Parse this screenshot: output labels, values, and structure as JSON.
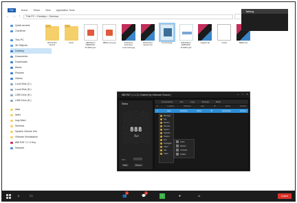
{
  "explorer": {
    "menu": [
      "File",
      "Home",
      "Share",
      "View",
      "Application Tools"
    ],
    "address": "This PC  >  Desktop  >  Seminar",
    "sidebar": [
      {
        "label": "Quick access",
        "color": "#4d8fd8"
      },
      {
        "label": "OneDrive",
        "color": "#4d8fd8"
      },
      {
        "label": "This PC",
        "color": "#4d8fd8"
      },
      {
        "label": "3D Objects",
        "color": "#5aa0e6"
      },
      {
        "label": "Desktop",
        "color": "#3b7fd1"
      },
      {
        "label": "Documents",
        "color": "#5f8fc2"
      },
      {
        "label": "Downloads",
        "color": "#3b7fd1"
      },
      {
        "label": "Music",
        "color": "#3b7fd1"
      },
      {
        "label": "Pictures",
        "color": "#3b7fd1"
      },
      {
        "label": "Videos",
        "color": "#3b7fd1"
      },
      {
        "label": "Local Disk (C:)",
        "color": "#8aa6c2"
      },
      {
        "label": "Local Disk (D:)",
        "color": "#8aa6c2"
      },
      {
        "label": "USB Drive (E:)",
        "color": "#8aa6c2"
      },
      {
        "label": "USB Drive (E:)",
        "color": "#8aa6c2"
      },
      {
        "label": "data",
        "color": "#f4cf6a"
      },
      {
        "label": "defer",
        "color": "#f4cf6a"
      },
      {
        "label": "Img-Ware",
        "color": "#f4cf6a"
      },
      {
        "label": "Seminar",
        "color": "#f4cf6a"
      },
      {
        "label": "System Volume Info",
        "color": "#f4cf6a"
      },
      {
        "label": "VMware Workstation",
        "color": "#f4cf6a"
      },
      {
        "label": "888 RAT 1.1.3 Key",
        "color": "#c32e5b"
      },
      {
        "label": "Network",
        "color": "#4d8fd8"
      }
    ],
    "files": [
      {
        "name": "BOOS Ref Injector",
        "kind": "folder"
      },
      {
        "name": "Florin",
        "kind": "folder"
      },
      {
        "name": "~$RATEGY-WEBINAR-SLIDES.pptx",
        "kind": "pdf"
      },
      {
        "name": "888rat-res.pptx",
        "kind": "pdf"
      },
      {
        "name": "advanced-keyboard-screenshot.jpg",
        "kind": "rar"
      },
      {
        "name": "BOOS Ref Injector.zip",
        "kind": "rar"
      },
      {
        "name": "Icomsi-0.jpg",
        "kind": "img"
      },
      {
        "name": "STRATEGY-WEBINAR-SLIDES.pptx",
        "kind": "docimg"
      },
      {
        "name": "Islagrat.zip",
        "kind": "rar"
      },
      {
        "name": "Infostl",
        "kind": "blank"
      },
      {
        "name": "888rat.zip",
        "kind": "rar"
      }
    ]
  },
  "talking": {
    "label": "Talking"
  },
  "rat_window": {
    "title": "888 RAT  |  1.1.3  |  Cracked by Unknown Source  |",
    "controls": [
      "—",
      "□",
      "✕"
    ],
    "left_tab": "Status",
    "logo": "888",
    "logo_sub": "Rat",
    "ports_label": "Port",
    "start_label": "Start",
    "listen_label": "Pause",
    "top_tabs": [
      "Connections",
      "Info",
      "Logs",
      "Settings",
      "Build"
    ],
    "columns": [
      "#",
      "Location",
      "Windows",
      "User",
      "IP",
      "Status",
      "Country"
    ],
    "row": [
      "1",
      "Auto",
      "Windows",
      "10Pro",
      "IP",
      "Connected",
      "Country"
    ],
    "context_menu": [
      "Manager",
      "Spy",
      "Monitor",
      "Remote",
      "System",
      "Network",
      "Plugins",
      "Fun",
      "Keylogger",
      "Client",
      "Info",
      "Close"
    ],
    "submenu": [
      "Close",
      "Restart",
      "Uninstall",
      "Update"
    ]
  },
  "taskbar": {
    "participants_label": "2",
    "chat_badge": "2",
    "leave_label": "Leave"
  }
}
